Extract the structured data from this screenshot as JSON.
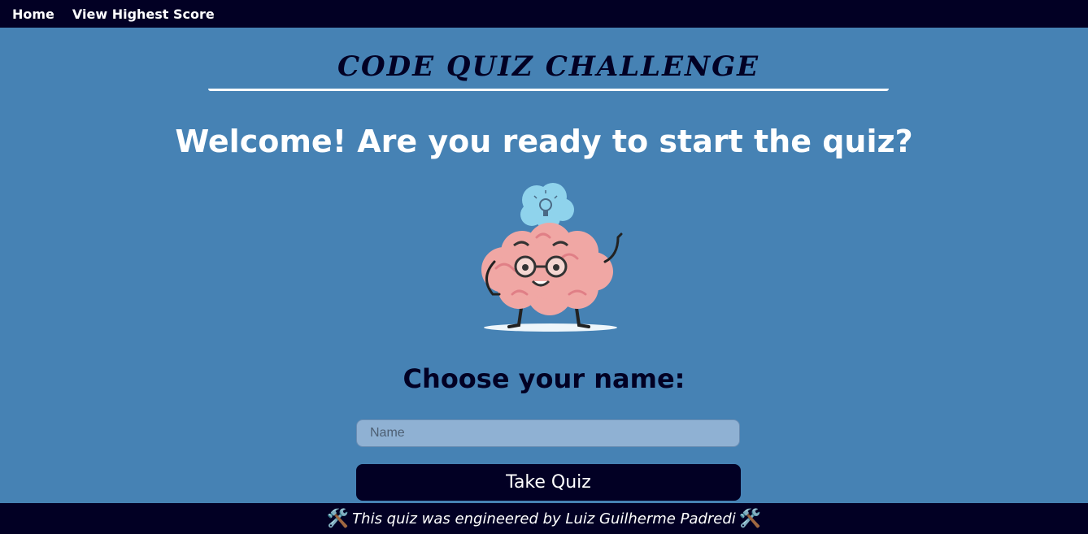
{
  "nav": {
    "home": "Home",
    "highscore": "View Highest Score"
  },
  "header": {
    "title": "CODE QUIZ CHALLENGE"
  },
  "main": {
    "welcome": "Welcome! Are you ready to start the quiz?",
    "choose_label": "Choose your name:",
    "name_placeholder": "Name",
    "name_value": "",
    "take_quiz_label": "Take Quiz",
    "illustration_icon": "brain-mascot-icon"
  },
  "footer": {
    "credit": "This quiz was engineered by Luiz Guilherme Padredi",
    "icon": "hammer-wrench-icon"
  },
  "colors": {
    "background": "#4682b4",
    "bar": "#020024",
    "input": "#8fb1d3"
  }
}
